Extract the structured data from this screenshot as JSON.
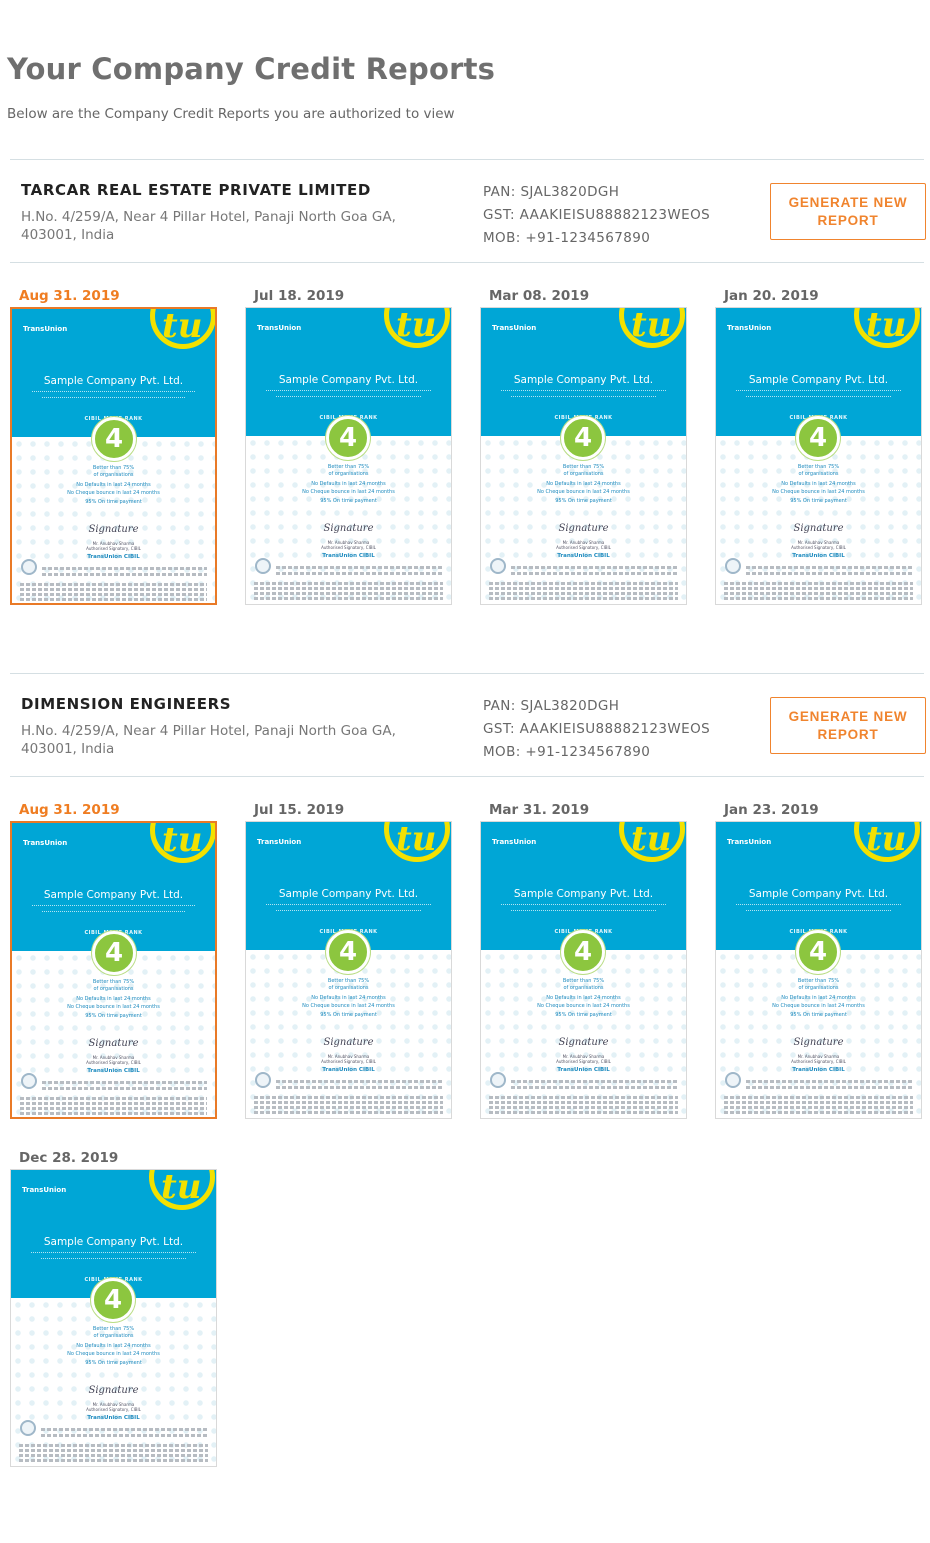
{
  "page": {
    "title": "Your Company Credit Reports",
    "subtitle": "Below are the Company Credit Reports you are authorized to view"
  },
  "report_preview": {
    "brand": "TransUnion",
    "company_name": "Sample Company Pvt. Ltd.",
    "rank_label": "CIBIL MSME RANK",
    "rank": "4",
    "better_than": "Better than 75%",
    "of_orgs": "of organisations",
    "line1": "No Defaults in last 24 months",
    "line2": "No Cheque bounce in last 24 months",
    "line3": "95% On time payment",
    "signatory": "Mr. Anubhav Sharma",
    "signatory_title": "Authorised Signatory, CIBIL",
    "footer_brand": "TransUnion CIBIL"
  },
  "companies": [
    {
      "name": "TARCAR REAL ESTATE PRIVATE LIMITED",
      "address": "H.No. 4/259/A, Near 4 Pillar Hotel, Panaji North Goa GA, 403001, India",
      "pan": "PAN: SJAL3820DGH",
      "gst": "GST: AAAKIEISU88882123WEOS",
      "mob": "MOB: +91-1234567890",
      "button_label": "GENERATE NEW REPORT",
      "reports": [
        {
          "date": "Aug 31. 2019",
          "latest": true
        },
        {
          "date": "Jul 18. 2019",
          "latest": false
        },
        {
          "date": "Mar 08. 2019",
          "latest": false
        },
        {
          "date": "Jan 20. 2019",
          "latest": false
        }
      ]
    },
    {
      "name": "DIMENSION ENGINEERS",
      "address": "H.No. 4/259/A, Near 4 Pillar Hotel, Panaji North Goa GA, 403001, India",
      "pan": "PAN: SJAL3820DGH",
      "gst": "GST: AAAKIEISU88882123WEOS",
      "mob": "MOB: +91-1234567890",
      "button_label": "GENERATE NEW REPORT",
      "reports": [
        {
          "date": "Aug 31. 2019",
          "latest": true
        },
        {
          "date": "Jul 15. 2019",
          "latest": false
        },
        {
          "date": "Mar 31. 2019",
          "latest": false
        },
        {
          "date": "Jan 23. 2019",
          "latest": false
        },
        {
          "date": "Dec 28. 2019",
          "latest": false
        }
      ]
    }
  ],
  "colors": {
    "accent": "#ef7d22",
    "report_band": "#00a6d6",
    "rank_circle": "#8cc63f",
    "logo_yellow": "#f3e100"
  }
}
